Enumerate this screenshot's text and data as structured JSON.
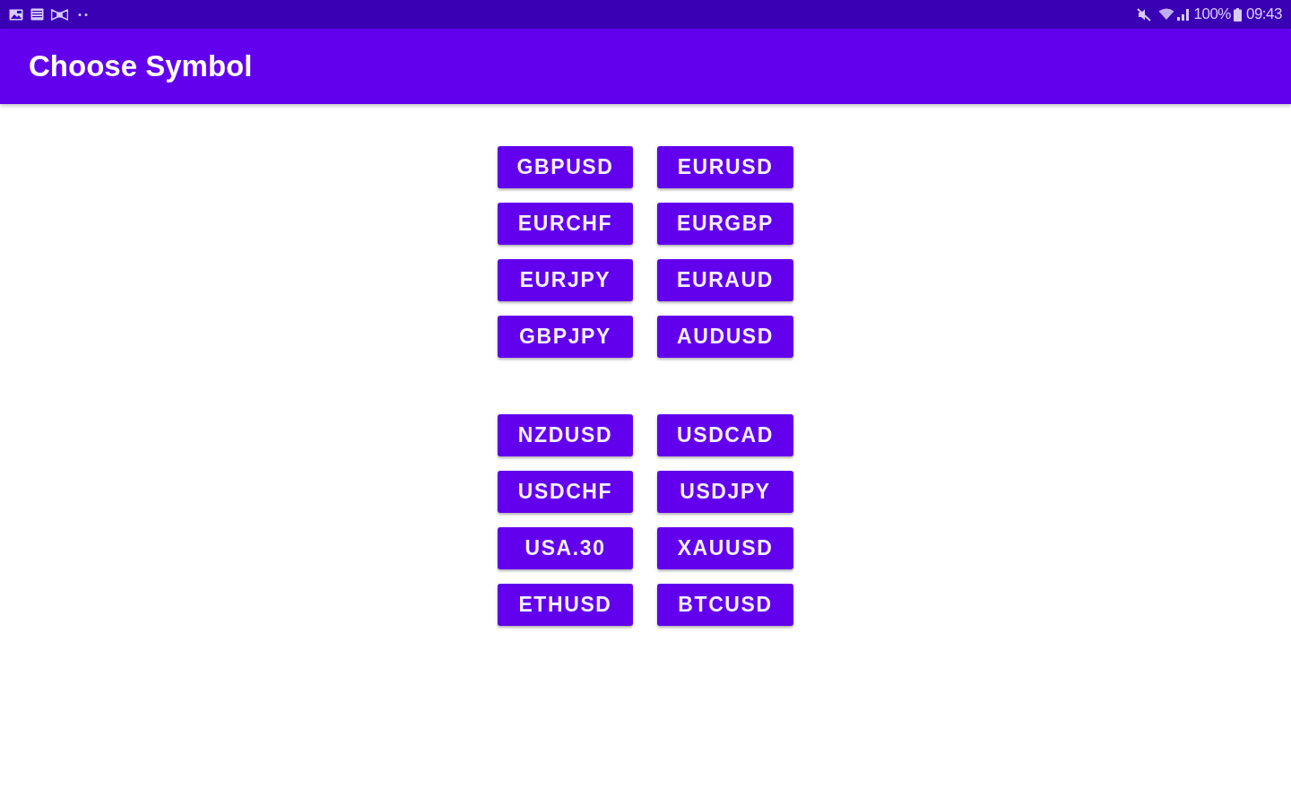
{
  "status_bar": {
    "battery": "100%",
    "time": "09:43"
  },
  "app_bar": {
    "title": "Choose Symbol"
  },
  "symbol_groups": [
    {
      "buttons": [
        "GBPUSD",
        "EURUSD",
        "EURCHF",
        "EURGBP",
        "EURJPY",
        "EURAUD",
        "GBPJPY",
        "AUDUSD"
      ]
    },
    {
      "buttons": [
        "NZDUSD",
        "USDCAD",
        "USDCHF",
        "USDJPY",
        "USA.30",
        "XAUUSD",
        "ETHUSD",
        "BTCUSD"
      ]
    }
  ]
}
